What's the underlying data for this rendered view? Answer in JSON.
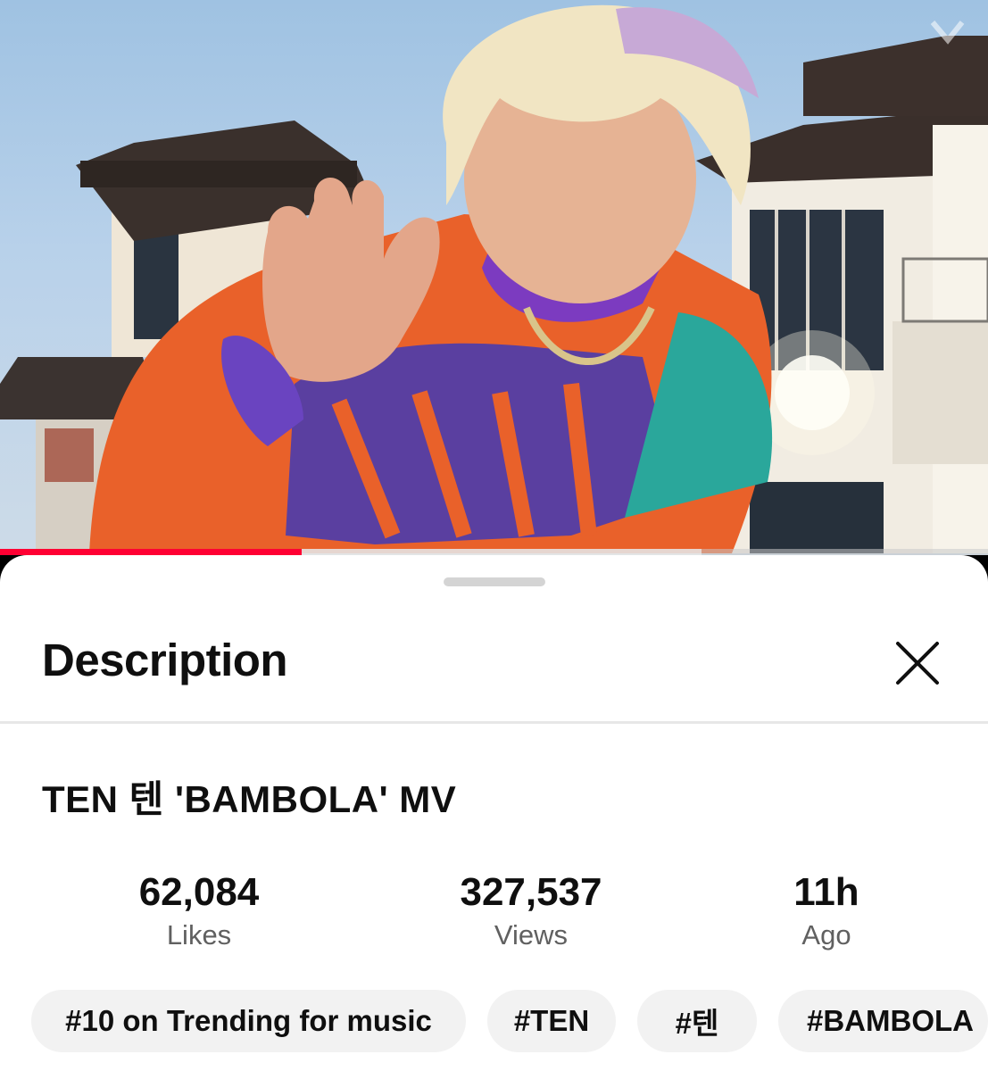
{
  "video": {
    "progress": 0.305,
    "buffered": 0.71,
    "progress_color": "#ff0033"
  },
  "sheet": {
    "title": "Description",
    "close_icon": "close-icon"
  },
  "video_info": {
    "title": "TEN 텐 'BAMBOLA' MV"
  },
  "stats": [
    {
      "value": "62,084",
      "label": "Likes"
    },
    {
      "value": "327,537",
      "label": "Views"
    },
    {
      "value": "11h",
      "label": "Ago"
    }
  ],
  "chips": [
    {
      "label": "#10 on Trending for music"
    },
    {
      "label": "#TEN"
    },
    {
      "label": "#텐"
    },
    {
      "label": "#BAMBOLA"
    }
  ]
}
